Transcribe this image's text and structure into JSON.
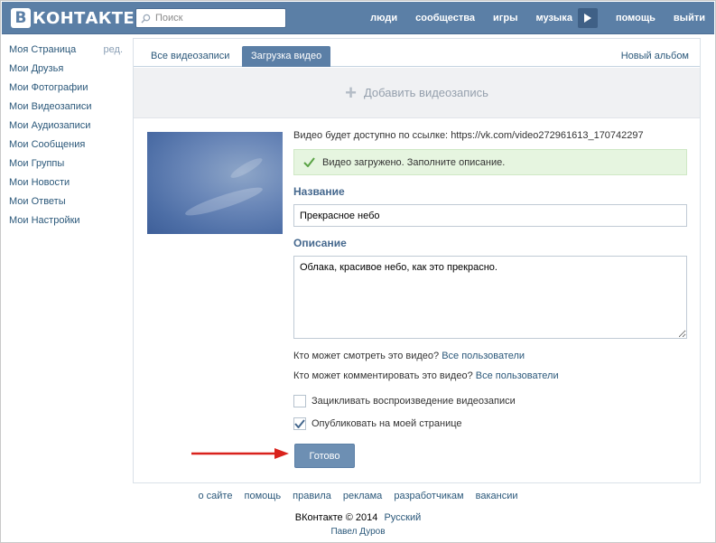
{
  "header": {
    "logo_letter": "В",
    "logo_text": "КОНТАКТЕ",
    "search_placeholder": "Поиск",
    "nav": [
      "люди",
      "сообщества",
      "игры",
      "музыка",
      "помощь",
      "выйти"
    ],
    "bg_color": "#5b7fa6"
  },
  "sidebar": {
    "edit_label": "ред.",
    "items": [
      "Моя Страница",
      "Мои Друзья",
      "Мои Фотографии",
      "Мои Видеозаписи",
      "Мои Аудиозаписи",
      "Мои Сообщения",
      "Мои Группы",
      "Мои Новости",
      "Мои Ответы",
      "Мои Настройки"
    ]
  },
  "tabs": {
    "all_videos": "Все видеозаписи",
    "upload": "Загрузка видео",
    "new_album": "Новый альбом"
  },
  "add_video": "Добавить видеозапись",
  "form": {
    "link_text": "Видео будет доступно по ссылке:",
    "link_url": "https://vk.com/video272961613_170742297",
    "success_text": "Видео загружено. Заполните описание.",
    "title_label": "Название",
    "title_value": "Прекрасное небо",
    "desc_label": "Описание",
    "desc_value": "Облака, красивое небо, как это прекрасно.",
    "view_privacy_label": "Кто может смотреть это видео?",
    "view_privacy_value": "Все пользователи",
    "comment_privacy_label": "Кто может комментировать это видео?",
    "comment_privacy_value": "Все пользователи",
    "loop_label": "Зацикливать воспроизведение видеозаписи",
    "loop_checked": false,
    "publish_label": "Опубликовать на моей странице",
    "publish_checked": true,
    "done_label": "Готово"
  },
  "footer": {
    "links": [
      "о сайте",
      "помощь",
      "правила",
      "реклама",
      "разработчикам",
      "вакансии"
    ],
    "copyright": "ВКонтакте © 2014",
    "language": "Русский",
    "author": "Павел Дуров"
  }
}
